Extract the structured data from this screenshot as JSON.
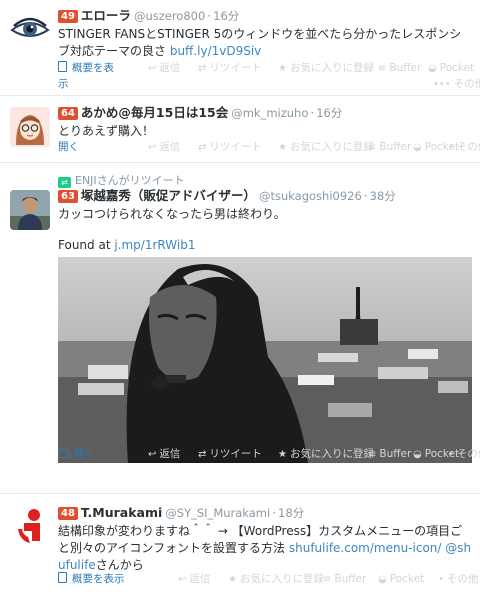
{
  "tweets": [
    {
      "badge": "49",
      "name": "エローラ",
      "handle": "@uszero800",
      "time": "16分",
      "text": "STINGER FANSとSTINGER 5のウィンドウを並べたら分かったレスポンシブ対応テーマの良さ ",
      "link": "buff.ly/1vD9Siv",
      "expand_label_1": "概要を表",
      "expand_label_2": "示",
      "actions": [
        "返信",
        "リツイート",
        "お気に入りに登録",
        "Buffer",
        "Pocket",
        "その他"
      ]
    },
    {
      "badge": "64",
      "name": "あかめ@毎月15日は15会",
      "handle": "@mk_mizuho",
      "time": "16分",
      "text": "とりあえず購入！",
      "expand_label": "開く",
      "actions": [
        "返信",
        "リツイート",
        "お気に入りに登録",
        "Buffer",
        "Pocket",
        "その他"
      ]
    },
    {
      "retweet_note": "ENJIさんがリツイート",
      "badge": "63",
      "name": "塚越嘉秀（販促アドバイザー）",
      "handle": "@tsukagoshi0926",
      "time": "38分",
      "text": "カッコつけられなくなったら男は終わり。",
      "found_at": "Found at ",
      "link": "j.mp/1rRWib1",
      "expand_label": "開く",
      "actions": [
        "返信",
        "リツイート",
        "お気に入りに登録",
        "Buffer",
        "Pocket",
        "その他"
      ]
    },
    {
      "badge": "48",
      "name": "T.Murakami",
      "handle": "@SY_SI_Murakami",
      "time": "18分",
      "text_1": "結構印象が変わりますね＾＾ → 【WordPress】カスタムメニューの項目ごと別々のアイコンフォントを設置する方法 ",
      "link_1": "shufulife.com/menu-icon/",
      "link_2": "@shufulife",
      "text_2": "さんから",
      "expand_label": "概要を表示",
      "actions": [
        "返信",
        "お気に入りに登録",
        "Buffer",
        "Pocket",
        "その他"
      ]
    }
  ],
  "dot": "·",
  "icons": {
    "reply": "reply-icon",
    "retweet": "retweet-icon",
    "favorite": "star-icon",
    "buffer": "buffer-icon",
    "pocket": "pocket-icon",
    "more": "more-icon"
  },
  "colors": {
    "badge": "#e0502e",
    "link": "#3b88c3",
    "muted": "#8899a6",
    "action": "#d0d6db",
    "retweet_green": "#19cf86"
  }
}
